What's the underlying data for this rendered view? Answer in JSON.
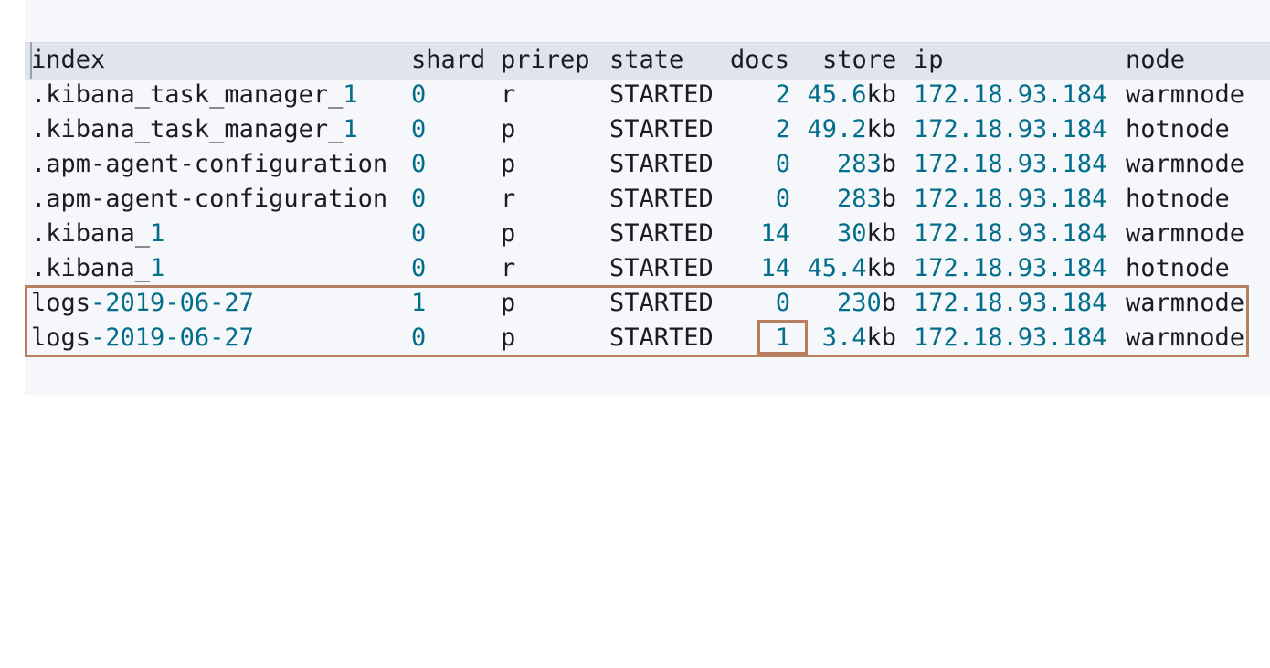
{
  "columns": {
    "index": "index",
    "shard": "shard",
    "prirep": "prirep",
    "state": "state",
    "docs": "docs",
    "store": "store",
    "ip": "ip",
    "node": "node"
  },
  "rows": [
    {
      "index_prefix": ".kibana_task_manager_",
      "index_suffix": "1",
      "shard": "0",
      "prirep": "r",
      "state": "STARTED",
      "docs": "2",
      "store_num": "45.6",
      "store_unit": "kb",
      "ip": "172.18.93.184",
      "node": "warmnode"
    },
    {
      "index_prefix": ".kibana_task_manager_",
      "index_suffix": "1",
      "shard": "0",
      "prirep": "p",
      "state": "STARTED",
      "docs": "2",
      "store_num": "49.2",
      "store_unit": "kb",
      "ip": "172.18.93.184",
      "node": "hotnode"
    },
    {
      "index_prefix": ".apm-agent-configuration",
      "index_suffix": "",
      "shard": "0",
      "prirep": "p",
      "state": "STARTED",
      "docs": "0",
      "store_num": "283",
      "store_unit": "b",
      "ip": "172.18.93.184",
      "node": "warmnode"
    },
    {
      "index_prefix": ".apm-agent-configuration",
      "index_suffix": "",
      "shard": "0",
      "prirep": "r",
      "state": "STARTED",
      "docs": "0",
      "store_num": "283",
      "store_unit": "b",
      "ip": "172.18.93.184",
      "node": "hotnode"
    },
    {
      "index_prefix": ".kibana_",
      "index_suffix": "1",
      "shard": "0",
      "prirep": "p",
      "state": "STARTED",
      "docs": "14",
      "store_num": "30",
      "store_unit": "kb",
      "ip": "172.18.93.184",
      "node": "warmnode"
    },
    {
      "index_prefix": ".kibana_",
      "index_suffix": "1",
      "shard": "0",
      "prirep": "r",
      "state": "STARTED",
      "docs": "14",
      "store_num": "45.4",
      "store_unit": "kb",
      "ip": "172.18.93.184",
      "node": "hotnode"
    },
    {
      "index_prefix": "logs",
      "index_suffix": "-2019-06-27",
      "shard": "1",
      "prirep": "p",
      "state": "STARTED",
      "docs": "0",
      "store_num": "230",
      "store_unit": "b",
      "ip": "172.18.93.184",
      "node": "warmnode"
    },
    {
      "index_prefix": "logs",
      "index_suffix": "-2019-06-27",
      "shard": "0",
      "prirep": "p",
      "state": "STARTED",
      "docs": "1",
      "store_num": "3.4",
      "store_unit": "kb",
      "ip": "172.18.93.184",
      "node": "warmnode"
    }
  ],
  "colors": {
    "number": "#006e8a",
    "text": "#1a1c21",
    "header_band": "#e0e4ec",
    "highlight": "#b87f5f"
  }
}
